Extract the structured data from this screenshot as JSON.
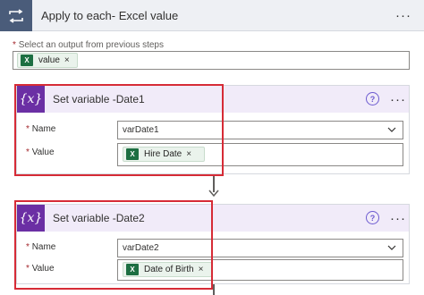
{
  "loop": {
    "title": "Apply to each- Excel value",
    "select_label": "Select an output from previous steps",
    "token": "value"
  },
  "cards": [
    {
      "title": "Set variable -Date1",
      "name_label": "Name",
      "name_value": "varDate1",
      "value_label": "Value",
      "value_token": "Hire Date"
    },
    {
      "title": "Set variable -Date2",
      "name_label": "Name",
      "name_value": "varDate2",
      "value_label": "Value",
      "value_token": "Date of Birth"
    }
  ],
  "glyphs": {
    "required": "*",
    "remove": "×",
    "more": "···",
    "help": "?",
    "excel": "X",
    "variable": "{x}"
  },
  "colors": {
    "loop_icon": "#4a5c7a",
    "variable_icon": "#6b2fa4",
    "excel_green": "#1d6f42",
    "highlight": "#d62b36"
  }
}
